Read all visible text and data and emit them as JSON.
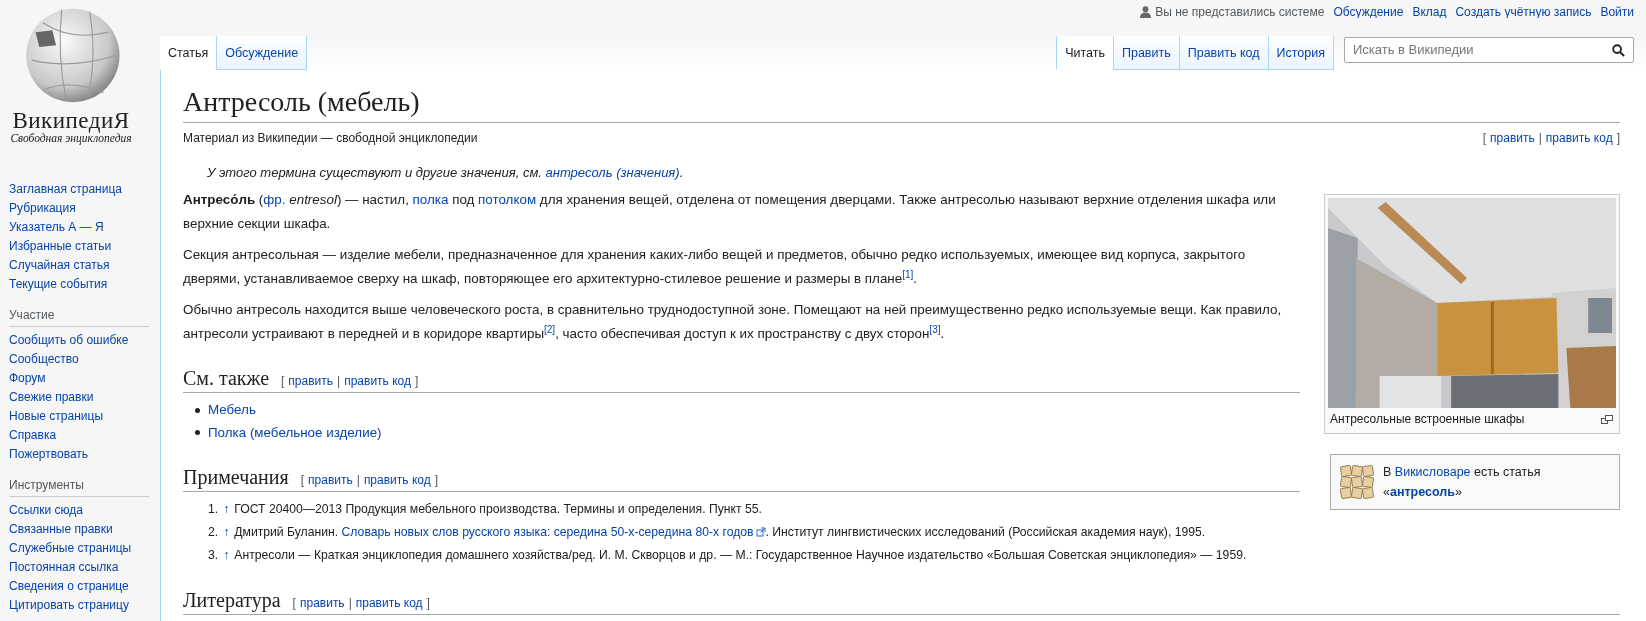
{
  "logo": {
    "wordmark": "ВикипедиЯ",
    "tagline": "Свободная энциклопедия"
  },
  "personal": {
    "status": "Вы не представились системе",
    "links": [
      "Обсуждение",
      "Вклад",
      "Создать учётную запись",
      "Войти"
    ]
  },
  "left_tabs": [
    {
      "label": "Статья",
      "selected": true
    },
    {
      "label": "Обсуждение",
      "selected": false
    }
  ],
  "right_tabs": [
    {
      "label": "Читать",
      "selected": true
    },
    {
      "label": "Править",
      "selected": false
    },
    {
      "label": "Править код",
      "selected": false
    },
    {
      "label": "История",
      "selected": false
    }
  ],
  "search": {
    "placeholder": "Искать в Википедии"
  },
  "sidebar": {
    "main": [
      "Заглавная страница",
      "Рубрикация",
      "Указатель А — Я",
      "Избранные статьи",
      "Случайная статья",
      "Текущие события"
    ],
    "groups": [
      {
        "heading": "Участие",
        "items": [
          "Сообщить об ошибке",
          "Сообщество",
          "Форум",
          "Свежие правки",
          "Новые страницы",
          "Справка",
          "Пожертвовать"
        ]
      },
      {
        "heading": "Инструменты",
        "items": [
          "Ссылки сюда",
          "Связанные правки",
          "Служебные страницы",
          "Постоянная ссылка",
          "Сведения о странице",
          "Цитировать страницу"
        ]
      }
    ]
  },
  "article": {
    "title": "Антресоль (мебель)",
    "subtitle": "Материал из Википедии — свободной энциклопедии",
    "edit_links": {
      "open": "[",
      "items": [
        "править",
        "править код"
      ],
      "separator": "|",
      "close": "]"
    },
    "hatnote": [
      {
        "kind": "text",
        "text": "У этого термина существуют и другие значения, см. "
      },
      {
        "kind": "link",
        "text": "антресоль (значения)"
      },
      {
        "kind": "text",
        "text": "."
      }
    ],
    "paragraphs": [
      [
        {
          "kind": "bold",
          "text": "Антресо́ль"
        },
        {
          "kind": "text",
          "text": " ("
        },
        {
          "kind": "link",
          "text": "фр."
        },
        {
          "kind": "italic",
          "text": " entresol"
        },
        {
          "kind": "text",
          "text": ") — настил, "
        },
        {
          "kind": "link",
          "text": "полка"
        },
        {
          "kind": "text",
          "text": " под "
        },
        {
          "kind": "link",
          "text": "потолком"
        },
        {
          "kind": "text",
          "text": " для хранения вещей, отделена от помещения дверцами. Также антресолью называют верхние отделения шкафа или верхние секции шкафа."
        }
      ],
      [
        {
          "kind": "text",
          "text": "Секция антресольная — изделие мебели, предназначенное для хранения каких-либо вещей и предметов, обычно редко используемых, имеющее вид корпуса, закрытого дверями, устанавливаемое сверху на шкаф, повторяющее его архитектурно-стилевое решение и размеры в плане"
        },
        {
          "kind": "ref",
          "text": "[1]"
        },
        {
          "kind": "text",
          "text": "."
        }
      ],
      [
        {
          "kind": "text",
          "text": "Обычно антресоль находится выше человеческого роста, в сравнительно труднодоступной зоне. Помещают на ней преимущественно редко используемые вещи. Как правило, антресоли устраивают в передней и в коридоре квартиры"
        },
        {
          "kind": "ref",
          "text": "[2]"
        },
        {
          "kind": "text",
          "text": ", часто обеспечивая доступ к их пространству с двух сторон"
        },
        {
          "kind": "ref",
          "text": "[3]"
        },
        {
          "kind": "text",
          "text": "."
        }
      ]
    ],
    "figure": {
      "kind": "picture",
      "caption": "Антресольные встроенные шкафы"
    },
    "wiktionary": [
      {
        "kind": "text",
        "text": "В "
      },
      {
        "kind": "link",
        "text": "Викисловаре"
      },
      {
        "kind": "text",
        "text": " есть статья «"
      },
      {
        "kind": "boldlink",
        "text": "антресоль"
      },
      {
        "kind": "text",
        "text": "»"
      }
    ],
    "sections": [
      {
        "heading": "См. также",
        "edit_links": {
          "open": "[",
          "items": [
            "править",
            "править код"
          ],
          "separator": "|",
          "close": "]"
        },
        "kind": "bullets",
        "items": [
          [
            {
              "kind": "link",
              "text": "Мебель"
            }
          ],
          [
            {
              "kind": "link",
              "text": "Полка (мебельное изделие)"
            }
          ]
        ]
      },
      {
        "heading": "Примечания",
        "edit_links": {
          "open": "[",
          "items": [
            "править",
            "править код"
          ],
          "separator": "|",
          "close": "]"
        },
        "kind": "notes",
        "items": [
          {
            "number": "1.",
            "backlink": "↑",
            "segments": [
              {
                "kind": "text",
                "text": "ГОСТ 20400—2013 Продукция мебельного производства. Термины и определения. Пункт 55."
              }
            ]
          },
          {
            "number": "2.",
            "backlink": "↑",
            "segments": [
              {
                "kind": "text",
                "text": "Дмитрий Буланин. "
              },
              {
                "kind": "extlink",
                "text": "Словарь новых слов русского языка: середина 50-х-середина 80-х годов"
              },
              {
                "kind": "text",
                "text": ". Институт лингвистических исследований (Российская академия наук), 1995."
              }
            ]
          },
          {
            "number": "3.",
            "backlink": "↑",
            "segments": [
              {
                "kind": "text",
                "text": "Антресоли — Краткая энциклопедия домашнего хозяйства/ред. И. М. Скворцов и др. — М.: Государственное Научное издательство «Большая Советская энциклопедия» — 1959."
              }
            ]
          }
        ]
      },
      {
        "heading": "Литература",
        "edit_links": {
          "open": "[",
          "items": [
            "править",
            "править код"
          ],
          "separator": "|",
          "close": "]"
        },
        "kind": "empty"
      }
    ]
  }
}
